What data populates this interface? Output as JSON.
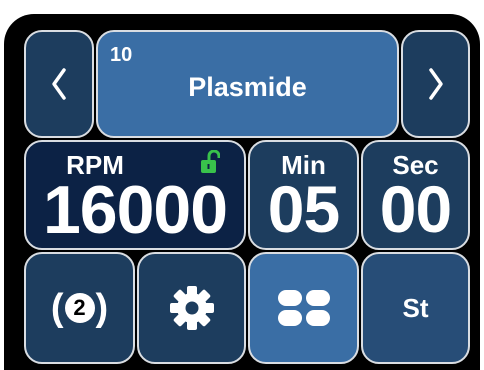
{
  "program": {
    "number": "10",
    "name": "Plasmide"
  },
  "rpm": {
    "label": "RPM",
    "value": "16000",
    "lock_state": "unlocked"
  },
  "minutes": {
    "label": "Min",
    "value": "05"
  },
  "seconds": {
    "label": "Sec",
    "value": "00"
  },
  "buttons": {
    "count_label": "2",
    "start_label": "St"
  },
  "colors": {
    "lock_icon": "#39c24b",
    "tile_dark": "#1d3d5e",
    "tile_navy": "#0c2245",
    "tile_blue": "#3a6ea5",
    "border": "#d9dde2"
  },
  "icons": [
    "chevron-left-icon",
    "chevron-right-icon",
    "unlock-icon",
    "gear-icon",
    "grid-icon"
  ]
}
